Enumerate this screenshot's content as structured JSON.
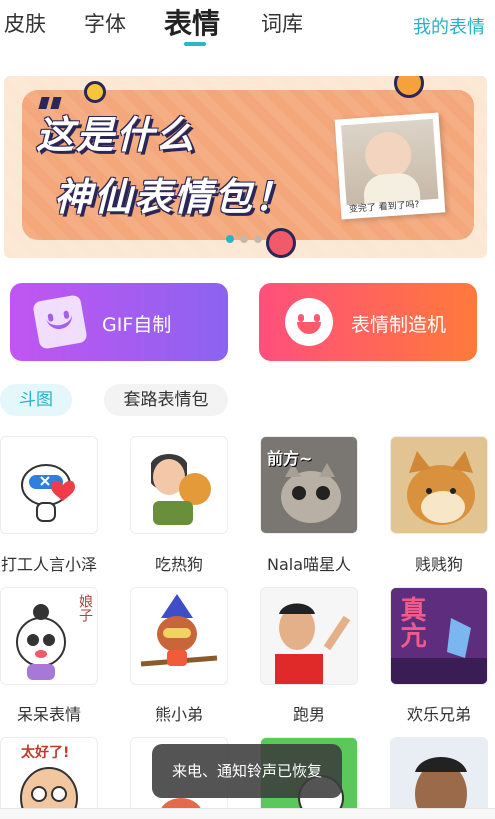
{
  "top_tabs": {
    "items": [
      {
        "label": "皮肤"
      },
      {
        "label": "字体"
      },
      {
        "label": "表情"
      },
      {
        "label": "词库"
      }
    ],
    "active_index": 2,
    "right_link": "我的表情",
    "accent_color": "#28b2c4"
  },
  "banner": {
    "title_line1": "这是什么",
    "title_line2": "神仙表情包！",
    "photo_caption": "变完了 看到了吗?",
    "dots_count": 3,
    "active_dot": 0
  },
  "features": {
    "gif_label": "GIF自制",
    "maker_label": "表情制造机"
  },
  "categories": {
    "items": [
      "斗图",
      "套路表情包"
    ],
    "active_index": 0
  },
  "grid": {
    "items": [
      {
        "label": "打工人言小泽",
        "icon": "blue-cat-sticker"
      },
      {
        "label": "吃热狗",
        "icon": "man-eating-sticker"
      },
      {
        "label": "Nala喵星人",
        "icon": "cat-photo-sticker",
        "overlay_text": "前方~"
      },
      {
        "label": "贱贱狗",
        "icon": "shiba-dog-sticker"
      },
      {
        "label": "呆呆表情",
        "icon": "girl-cartoon-sticker",
        "overlay_text": "娘子"
      },
      {
        "label": "熊小弟",
        "icon": "bear-witch-sticker"
      },
      {
        "label": "跑男",
        "icon": "man-cheering-sticker"
      },
      {
        "label": "欢乐兄弟",
        "icon": "purple-text-sticker",
        "overlay_text": "真亢"
      },
      {
        "icon": "old-man-sticker",
        "overlay_text": "太好了!"
      },
      {
        "icon": "cartoon-sticker"
      },
      {
        "icon": "green-cartoon-sticker"
      },
      {
        "icon": "man-face-sticker"
      }
    ]
  },
  "toast": {
    "message": "来电、通知铃声已恢复"
  }
}
